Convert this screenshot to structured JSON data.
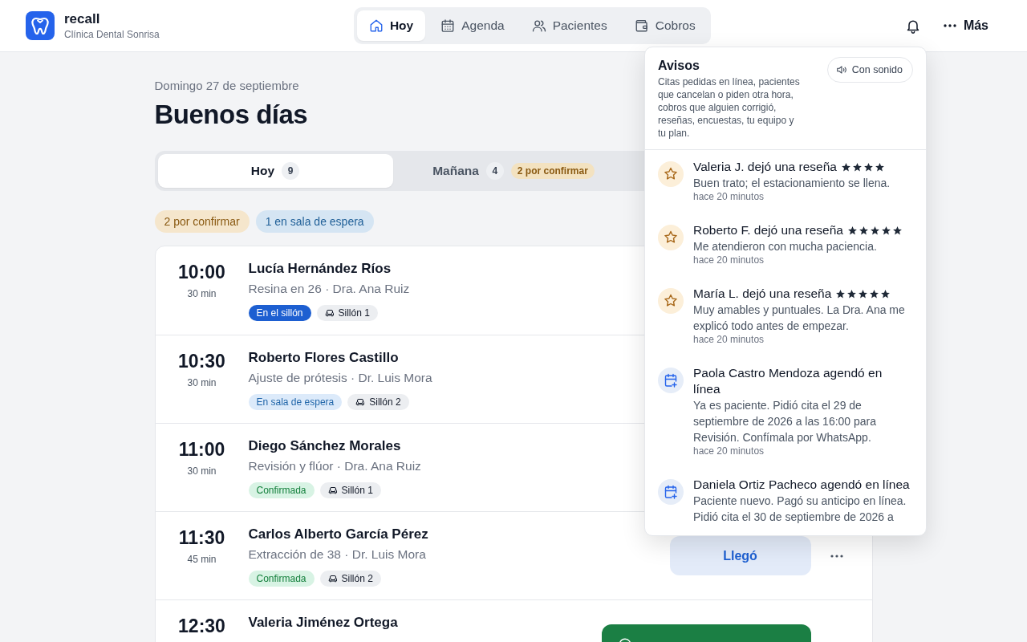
{
  "header": {
    "brand": {
      "name": "recall",
      "subtitle": "Clínica Dental Sonrisa"
    },
    "nav": [
      {
        "kind": "today",
        "label": "Hoy",
        "selected": true
      },
      {
        "kind": "agenda",
        "label": "Agenda",
        "selected": false
      },
      {
        "kind": "patients",
        "label": "Pacientes",
        "selected": false
      },
      {
        "kind": "billing",
        "label": "Cobros",
        "selected": false
      }
    ],
    "more_label": "Más"
  },
  "page": {
    "date": "Domingo 27 de septiembre",
    "greeting": "Buenos días"
  },
  "day_tabs": [
    {
      "label": "Hoy",
      "count": "9",
      "selected": true
    },
    {
      "label": "Mañana",
      "count": "4",
      "badge": "2 por confirmar",
      "selected": false
    }
  ],
  "filters": [
    {
      "kind": "pending",
      "label": "2 por confirmar"
    },
    {
      "kind": "waiting",
      "label": "1 en sala de espera"
    }
  ],
  "appointments": [
    {
      "time": "10:00",
      "duration": "30 min",
      "patient": "Lucía Hernández Ríos",
      "detail": "Resina en 26 · Dra. Ana Ruiz",
      "status": {
        "kind": "in_chair",
        "label": "En el sillón"
      },
      "chair": "Sillón 1"
    },
    {
      "time": "10:30",
      "duration": "30 min",
      "patient": "Roberto Flores Castillo",
      "detail": "Ajuste de prótesis · Dr. Luis Mora",
      "status": {
        "kind": "waiting",
        "label": "En sala de espera"
      },
      "chair": "Sillón 2"
    },
    {
      "time": "11:00",
      "duration": "30 min",
      "patient": "Diego Sánchez Morales",
      "detail": "Revisión y flúor · Dra. Ana Ruiz",
      "status": {
        "kind": "confirmed",
        "label": "Confirmada"
      },
      "chair": "Sillón 1"
    },
    {
      "time": "11:30",
      "duration": "45 min",
      "patient": "Carlos Alberto García Pérez",
      "detail": "Extracción de 38 · Dr. Luis Mora",
      "status": {
        "kind": "confirmed",
        "label": "Confirmada"
      },
      "chair": "Sillón 2",
      "actions": [
        {
          "kind": "arrived",
          "label": "Llegó"
        },
        {
          "kind": "more"
        }
      ]
    },
    {
      "time": "12:30",
      "patient": "Valeria Jiménez Ortega",
      "actions": [
        {
          "kind": "chat"
        }
      ]
    }
  ],
  "notifications": {
    "title": "Avisos",
    "description": "Citas pedidas en línea, pacientes que cancelan o piden otra hora, cobros que alguien corrigió, reseñas, encuestas, tu equipo y tu plan.",
    "sound_label": "Con sonido",
    "items": [
      {
        "kind": "review",
        "title": "Valeria J. dejó una reseña",
        "stars": 4,
        "body": "Buen trato; el estacionamiento se llena.",
        "time": "hace 20 minutos"
      },
      {
        "kind": "review",
        "title": "Roberto F. dejó una reseña",
        "stars": 5,
        "body": "Me atendieron con mucha paciencia.",
        "time": "hace 20 minutos"
      },
      {
        "kind": "review",
        "title": "María L. dejó una reseña",
        "stars": 5,
        "body": "Muy amables y puntuales. La Dra. Ana me explicó todo antes de empezar.",
        "time": "hace 20 minutos"
      },
      {
        "kind": "booking",
        "title": "Paola Castro Mendoza agendó en línea",
        "body": "Ya es paciente. Pidió cita el 29 de septiembre de 2026 a las 16:00 para Revisión. Confímala por WhatsApp.",
        "time": "hace 20 minutos"
      },
      {
        "kind": "booking",
        "title": "Daniela Ortiz Pacheco agendó en línea",
        "body": "Paciente nuevo. Pagó su anticipo en línea. Pidió cita el 30 de septiembre de 2026 a"
      }
    ]
  }
}
